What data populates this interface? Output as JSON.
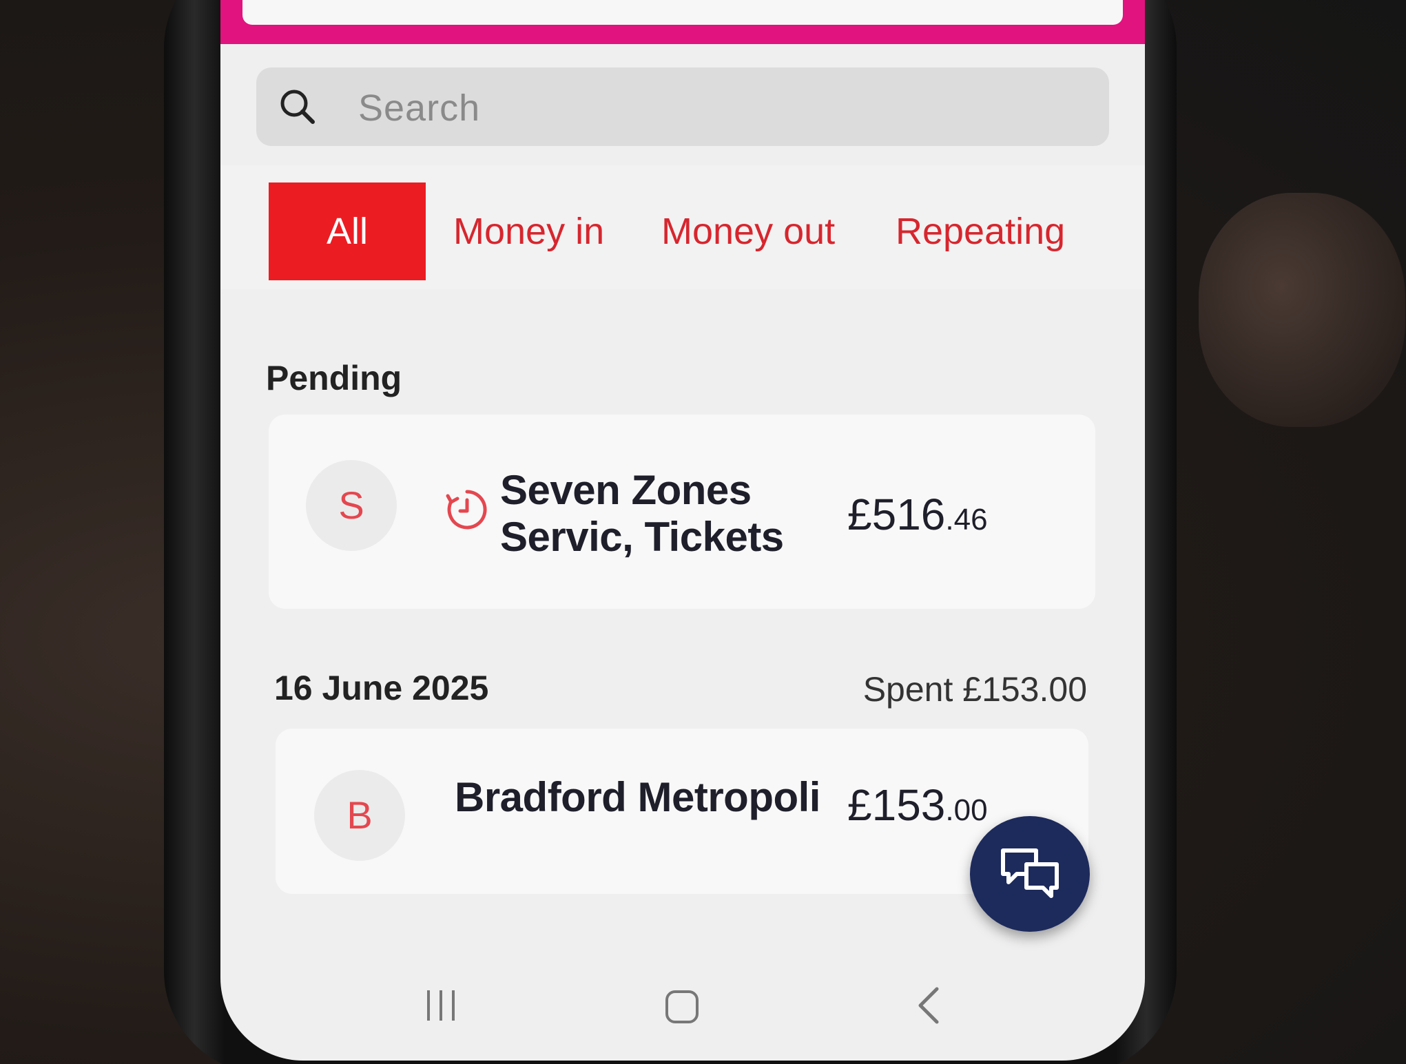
{
  "search": {
    "placeholder": "Search",
    "icon": "search-icon"
  },
  "tabs": [
    {
      "label": "All",
      "active": true
    },
    {
      "label": "Money in",
      "active": false
    },
    {
      "label": "Money out",
      "active": false
    },
    {
      "label": "Repeating",
      "active": false
    }
  ],
  "pending": {
    "heading": "Pending",
    "transaction": {
      "avatar_letter": "S",
      "status_icon": "clock-pending-icon",
      "merchant_line1": "Seven Zones",
      "merchant_line2": "Servic,  Tickets",
      "amount_major": "£516",
      "amount_minor": ".46"
    }
  },
  "day_group": {
    "date": "16 June 2025",
    "spent": "Spent £153.00",
    "transaction": {
      "avatar_letter": "B",
      "merchant": "Bradford Metropoli",
      "amount_major": "£153",
      "amount_minor": ".00"
    }
  },
  "chat_button": {
    "icon": "chat-bubbles-icon"
  },
  "system_nav": {
    "recents_icon": "recents-icon",
    "home_icon": "home-icon",
    "back_icon": "back-icon"
  },
  "colors": {
    "brand_pink": "#e0137f",
    "active_tab": "#ec1c23",
    "tab_text": "#d7262e",
    "fab": "#1d2a5c"
  }
}
